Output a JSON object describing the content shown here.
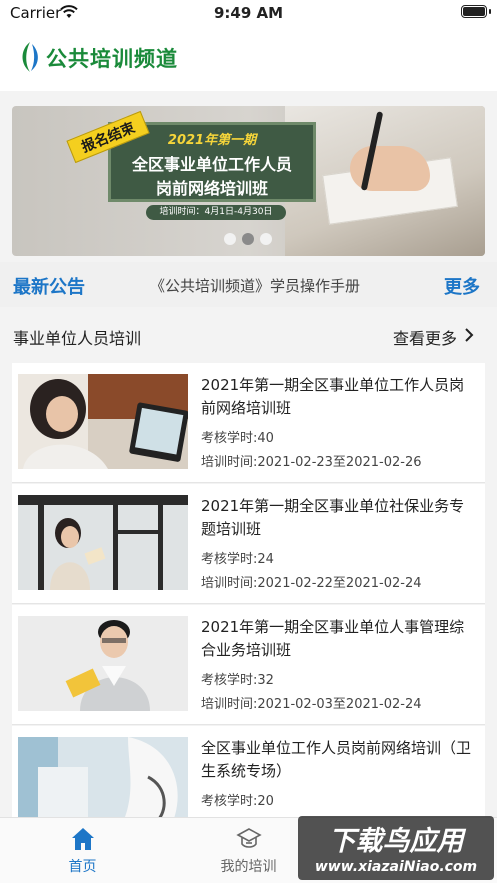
{
  "status_bar": {
    "carrier": "Carrier",
    "time": "9:49 AM"
  },
  "header": {
    "logo_text": "公共培训频道",
    "logo_icon": "leaf-logo-icon"
  },
  "banner": {
    "ribbon": "报名结束",
    "year_line": "2021年第一期",
    "line1": "全区事业单位工作人员",
    "line2": "岗前网络培训班",
    "date": "培训时间：4月1日-4月30日",
    "dots_total": 3,
    "dots_active_index": 1
  },
  "notice": {
    "title": "最新公告",
    "text": "《公共培训频道》学员操作手册",
    "more": "更多"
  },
  "section": {
    "title": "事业单位人员培训",
    "more": "查看更多"
  },
  "courses": [
    {
      "title": "2021年第一期全区事业单位工作人员岗前网络培训班",
      "hours": "考核学时:40",
      "time": "培训时间:2021-02-23至2021-02-26"
    },
    {
      "title": "2021年第一期全区事业单位社保业务专题培训班",
      "hours": "考核学时:24",
      "time": "培训时间:2021-02-22至2021-02-24"
    },
    {
      "title": "2021年第一期全区事业单位人事管理综合业务培训班",
      "hours": "考核学时:32",
      "time": "培训时间:2021-02-03至2021-02-24"
    },
    {
      "title": "全区事业单位工作人员岗前网络培训（卫生系统专场）",
      "hours": "考核学时:20",
      "time": ""
    }
  ],
  "tabs": [
    {
      "label": "首页",
      "icon": "home-icon",
      "active": true
    },
    {
      "label": "我的培训",
      "icon": "graduation-cap-icon",
      "active": false
    }
  ],
  "watermark": {
    "line1": "下载鸟应用",
    "line2": "www.xiazaiNiao.com"
  },
  "colors": {
    "accent": "#1d76c7",
    "logo_green": "#1a8a3a",
    "tab_active": "#1d76c7",
    "tab_inactive": "#666666"
  }
}
